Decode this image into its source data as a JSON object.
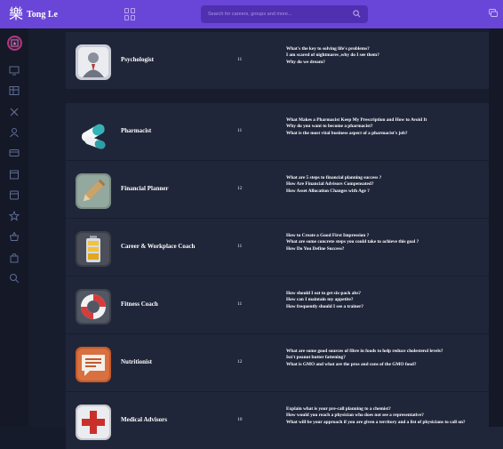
{
  "header": {
    "brand_glyph": "樂",
    "brand_name": "Tong Le",
    "search_placeholder": "Search for careers, groups and more..."
  },
  "sidebar": {
    "icons": [
      "monitor-icon",
      "table-icon",
      "tools-icon",
      "user-icon",
      "card-icon",
      "calendar-icon",
      "calendar-alt-icon",
      "star-icon",
      "basket-icon",
      "bag-icon",
      "search-icon"
    ]
  },
  "careers": [
    {
      "title": "Psychologist",
      "count": "11",
      "icon": "psychologist-icon",
      "questions": [
        "What's the key to solving life's problems?",
        "I am scared of nightmares ,why do I see them?",
        "Why do we dream?"
      ]
    },
    {
      "title": "Pharmacist",
      "count": "11",
      "icon": "pills-icon",
      "questions": [
        "What Makes a Pharmacist Keep My Prescription and How to Avoid It",
        "Why do you want to become a pharmacist?",
        "What is the most vital business aspect of a pharmacist's job?"
      ]
    },
    {
      "title": "Financial Planner",
      "count": "12",
      "icon": "pencil-icon",
      "questions": [
        "What are 5 steps to financial planning success ?",
        "How Are Financial Advisors Compensated?",
        "How Asset Allocation Changes with Age ?"
      ]
    },
    {
      "title": "Career & Workplace Coach",
      "count": "11",
      "icon": "battery-icon",
      "questions": [
        "How to Create a Good First Impression ?",
        "What are some concrete steps you could take to achieve this goal ?",
        "How Do You Define Success?"
      ]
    },
    {
      "title": "Fitness Coach",
      "count": "11",
      "icon": "lifebuoy-icon",
      "questions": [
        "How should I eat to get six-pack abs?",
        "How can I maintain my appetite?",
        "How frequently should I see a trainer?"
      ]
    },
    {
      "title": "Nutritionist",
      "count": "12",
      "icon": "chat-bubble-icon",
      "questions": [
        "What are some good sources of fibre in foods to help reduce cholesterol levels?",
        "Isn't peanut butter fattening?",
        "What is GMO and what are the pros and cons of the GMO food?"
      ]
    },
    {
      "title": "Medical Advisors",
      "count": "10",
      "icon": "medical-cross-icon",
      "questions": [
        "Explain what is your pre-call planning to a chemist?",
        "How would you reach a physician who does not see a representative?",
        "What will be your approach if you are given a territory and a list of physicians to call on?"
      ]
    }
  ],
  "colors": {
    "topbar": "#6a46d8",
    "background": "#161b2b",
    "row": "#20263a",
    "sidebar": "#141827"
  }
}
